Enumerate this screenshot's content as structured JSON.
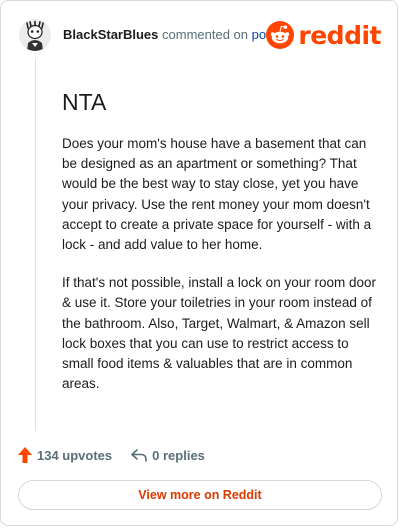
{
  "header": {
    "author": "BlackStarBlues",
    "action_text": "commented on",
    "post_link": "post",
    "logo_text": "reddit"
  },
  "comment": {
    "title": "NTA",
    "paragraphs": [
      "Does your mom's house have a basement that can be designed as an apartment or something? That would be the best way to stay close, yet you have your privacy. Use the rent money your mom doesn't accept to create a private space for yourself - with a lock - and add value to her home.",
      "If that's not possible, install a lock on your room door & use it. Store your toiletries in your room instead of the bathroom. Also, Target, Walmart, & Amazon sell lock boxes that you can use to restrict access to small food items & valuables that are in common areas."
    ]
  },
  "footer": {
    "upvotes": "134 upvotes",
    "replies": "0 replies",
    "upvote_icon": "upvote-arrow-icon",
    "reply_icon": "reply-arrow-icon"
  },
  "view_more_label": "View more on Reddit",
  "colors": {
    "brand": "#ff4500",
    "link": "#0045ac",
    "muted": "#576f76",
    "view_more": "#d93a00"
  }
}
